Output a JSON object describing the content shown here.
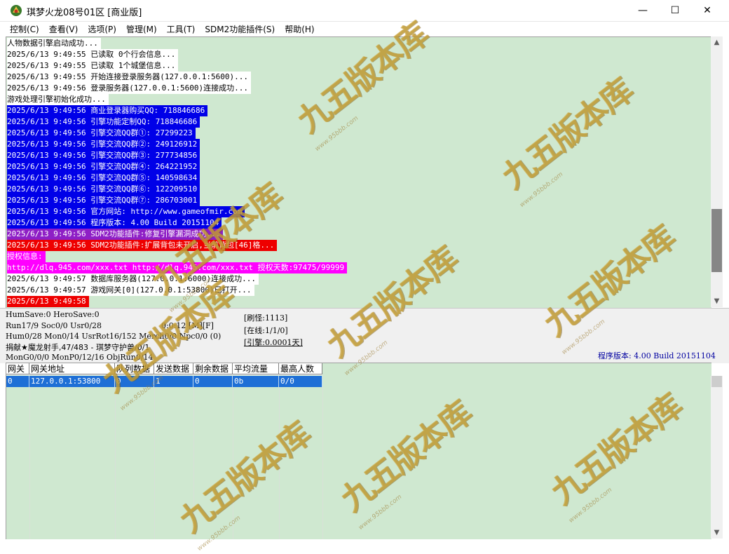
{
  "window": {
    "title": "琪梦火龙08号01区 [商业版]",
    "controls": {
      "minimize": "—",
      "maximize": "☐",
      "close": "✕"
    }
  },
  "menu": [
    "控制(C)",
    "查看(V)",
    "选项(P)",
    "管理(M)",
    "工具(T)",
    "SDM2功能插件(S)",
    "帮助(H)"
  ],
  "log": [
    {
      "text": "人物数据引擎启动成功...",
      "style": "white"
    },
    {
      "text": "2025/6/13 9:49:55 已读取 0个行会信息...",
      "style": "white"
    },
    {
      "text": "2025/6/13 9:49:55 已读取 1个城堡信息...",
      "style": "white"
    },
    {
      "text": "2025/6/13 9:49:55 开始连接登录服务器(127.0.0.1:5600)...",
      "style": "white"
    },
    {
      "text": "2025/6/13 9:49:56 登录服务器(127.0.0.1:5600)连接成功...",
      "style": "white"
    },
    {
      "text": "游戏处理引擎初始化成功...",
      "style": "white"
    },
    {
      "text": "2025/6/13 9:49:56 商业登录器购买QQ: 718846686",
      "style": "blue"
    },
    {
      "text": "2025/6/13 9:49:56 引擎功能定制QQ: 718846686",
      "style": "blue"
    },
    {
      "text": "2025/6/13 9:49:56 引擎交流QQ群①: 27299223",
      "style": "blue"
    },
    {
      "text": "2025/6/13 9:49:56 引擎交流QQ群②: 249126912",
      "style": "blue"
    },
    {
      "text": "2025/6/13 9:49:56 引擎交流QQ群③: 277734856",
      "style": "blue"
    },
    {
      "text": "2025/6/13 9:49:56 引擎交流QQ群④: 264221952",
      "style": "blue"
    },
    {
      "text": "2025/6/13 9:49:56 引擎交流QQ群⑤: 140598634",
      "style": "blue"
    },
    {
      "text": "2025/6/13 9:49:56 引擎交流QQ群⑥: 122209510",
      "style": "blue"
    },
    {
      "text": "2025/6/13 9:49:56 引擎交流QQ群⑦: 286703001",
      "style": "blue"
    },
    {
      "text": "2025/6/13 9:49:56 官方网站: http://www.gameofmir.com",
      "style": "blue"
    },
    {
      "text": "2025/6/13 9:49:56 程序版本: 4.00 Build 20151104",
      "style": "blue"
    },
    {
      "text": "2025/6/13 9:49:56 SDM2功能插件:修复引擎漏洞成功...",
      "style": "purple"
    },
    {
      "text": "2025/6/13 9:49:56 SDM2功能插件:扩展背包未开启,当前背包[46]格...",
      "style": "red"
    },
    {
      "text": "授权信息:",
      "style": "magenta"
    },
    {
      "text": "http://dlq.945.com/xxx.txt http://dlq.945.com/xxx.txt 授权天数:97475/99999",
      "style": "magenta"
    },
    {
      "text": "2025/6/13 9:49:57 数据库服务器(127.0.0.1:6000)连接成功...",
      "style": "white"
    },
    {
      "text": "2025/6/13 9:49:57 游戏网关[0](127.0.0.1:53800)已打开...",
      "style": "white"
    },
    {
      "text": "2025/6/13 9:49:58",
      "style": "red"
    }
  ],
  "status": {
    "line1": "HumSave:0 HeroSave:0",
    "line2": "Run17/9 Soc0/0 Usr0/28",
    "timer": "0:0:12 [M][F]",
    "line3": "Hum0/28 Mon0/14 UsrRot16/152 Merch0/0 Npc0/0 (0)",
    "line4": "捐献★魔龙射手,47/483 - 琪梦守护兽/0/1",
    "line5": "MonG0/0/0 MonP0/12/16 ObjRun0/14",
    "refresh": "[刷怪:1113]",
    "online": "[在线:1/1/0]",
    "engine": "[引擎:0.0001天]",
    "version": "程序版本: 4.00 Build 20151104"
  },
  "grid": {
    "columns": [
      "网关",
      "网关地址",
      "队列数据",
      "发送数据",
      "剩余数据",
      "平均流量",
      "最高人数"
    ],
    "rows": [
      [
        "0",
        "127.0.0.1:53800",
        "0",
        "1",
        "0",
        "0b",
        "0/0"
      ]
    ]
  },
  "watermark": {
    "text": "九五版本库",
    "url": "www.95bbb.com"
  },
  "colors": {
    "background": "#cfe8d0",
    "log_blue": "#0000e8",
    "log_red": "#ee0000",
    "log_magenta": "#ff00ff",
    "log_purple": "#8e1fc6",
    "selection": "#1e6fd6"
  },
  "icons": {
    "app": "dragon-app-icon",
    "scroll_up": "scroll-up-arrow-icon",
    "scroll_down": "scroll-down-arrow-icon"
  }
}
